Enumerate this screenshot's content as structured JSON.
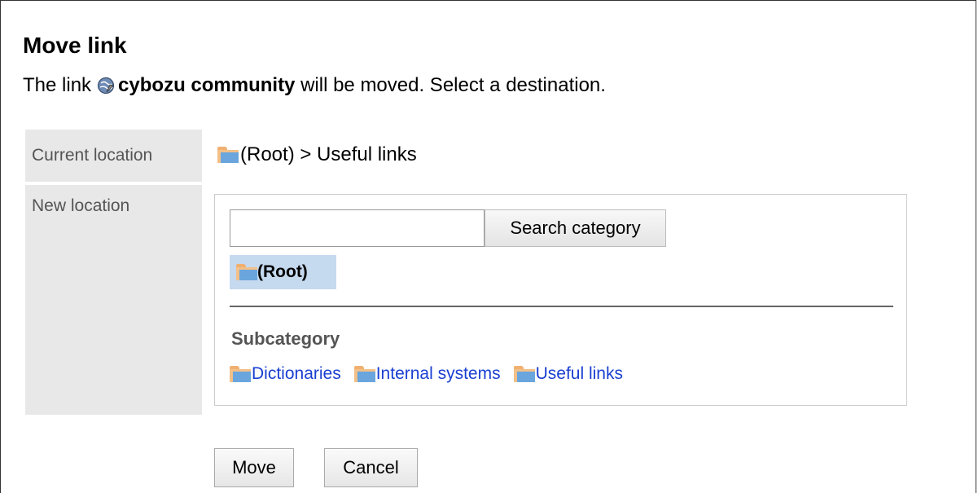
{
  "title": "Move link",
  "description": {
    "prefix": "The link",
    "link_name": "cybozu community",
    "suffix": "will be moved. Select a destination."
  },
  "current_location": {
    "label": "Current location",
    "value": "(Root) > Useful links"
  },
  "new_location": {
    "label": "New location",
    "search_input_value": "",
    "search_button": "Search category",
    "selected": "(Root)",
    "subcategory_title": "Subcategory",
    "subcategories": [
      "Dictionaries",
      "Internal systems",
      "Useful links"
    ]
  },
  "buttons": {
    "move": "Move",
    "cancel": "Cancel"
  },
  "colors": {
    "link": "#1a3fd1",
    "selected_bg": "#c5d9ef",
    "label_bg": "#e8e8e8"
  }
}
